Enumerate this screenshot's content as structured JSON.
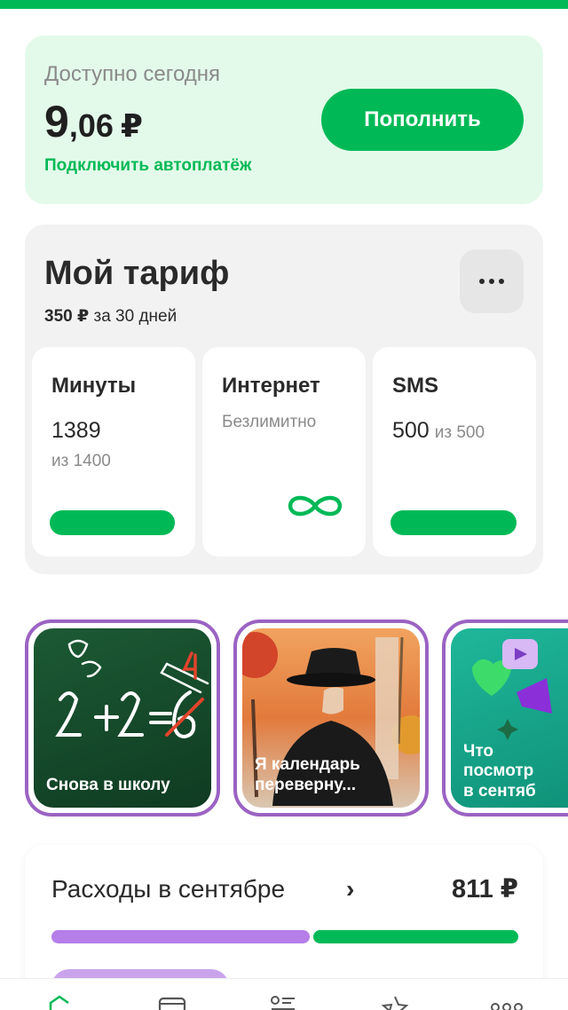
{
  "balance": {
    "label": "Доступно сегодня",
    "amount_int": "9",
    "amount_frac": ",06",
    "currency": "₽",
    "autopay_link": "Подключить автоплатёж",
    "topup_button": "Пополнить"
  },
  "tariff": {
    "title": "Мой тариф",
    "price": "350 ₽",
    "period": "за 30 дней",
    "tiles": {
      "minutes": {
        "title": "Минуты",
        "value": "1389",
        "total": "из 1400",
        "remaining_fraction": 0.99
      },
      "internet": {
        "title": "Интернет",
        "value": "Безлимитно"
      },
      "sms": {
        "title": "SMS",
        "value": "500",
        "total": "из 500",
        "remaining_fraction": 1.0
      }
    }
  },
  "stories": [
    {
      "caption": "Снова в школу"
    },
    {
      "caption": "Я календарь переверну..."
    },
    {
      "caption_lines": [
        "Что",
        "посмотр",
        "в сентяб"
      ]
    }
  ],
  "expenses": {
    "title": "Расходы в сентябре",
    "amount": "811 ₽",
    "segments": [
      {
        "color": "#b57ee8",
        "fraction": 0.56
      },
      {
        "color": "#00b956",
        "fraction": 0.44
      }
    ]
  },
  "colors": {
    "brand_green": "#00b956",
    "balance_bg": "#e3faea",
    "story_border": "#9b63c3"
  },
  "bottom_nav_icons": [
    "home-icon",
    "wallet-icon",
    "services-list-icon",
    "star-icon",
    "more-icon"
  ]
}
